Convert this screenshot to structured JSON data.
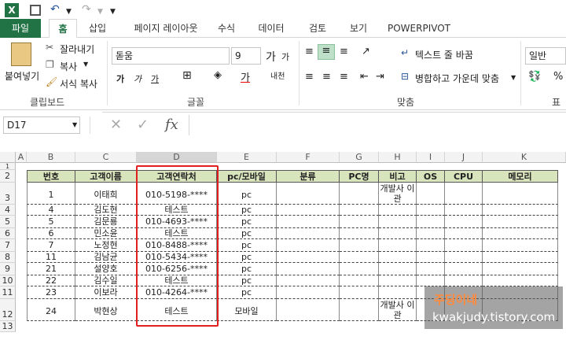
{
  "qat": {
    "excel_icon": "X",
    "save_icon": "save",
    "undo_icon": "↶",
    "redo_icon": "↷"
  },
  "tabs": [
    {
      "label": "파일"
    },
    {
      "label": "홈"
    },
    {
      "label": "삽입"
    },
    {
      "label": "페이지 레이아웃"
    },
    {
      "label": "수식"
    },
    {
      "label": "데이터"
    },
    {
      "label": "검토"
    },
    {
      "label": "보기"
    },
    {
      "label": "POWERPIVOT"
    }
  ],
  "ribbon": {
    "paste": "붙여넣기",
    "cut": "잘라내기",
    "copy": "복사",
    "format_painter": "서식 복사",
    "clipboard": "클립보드",
    "font_name": "돋움",
    "font_size": "9",
    "font_group": "글꼴",
    "grow": "가",
    "shrink": "가",
    "bold": "가",
    "italic": "가",
    "underline": "가",
    "font_color": "가",
    "phonetic": "내천",
    "wrap_text": "텍스트 줄 바꿈",
    "merge_center": "병합하고 가운데 맞춤",
    "align_group": "맞춤",
    "number_format": "일반",
    "number_group": "표시"
  },
  "formula": {
    "namebox": "D17",
    "fx": "fx",
    "cancel": "✕",
    "enter": "✓"
  },
  "columns": [
    "A",
    "B",
    "C",
    "D",
    "E",
    "F",
    "G",
    "H",
    "I",
    "J",
    "K"
  ],
  "header_row": [
    "번호",
    "고객이름",
    "고객연락처",
    "pc/모바일",
    "분류",
    "PC명",
    "비고",
    "OS",
    "CPU",
    "메모리"
  ],
  "rows": [
    {
      "rownum": "3",
      "no": "1",
      "name": "이태희",
      "phone": "010-5198-****",
      "type": "pc",
      "note": "개발사 이관"
    },
    {
      "rownum": "4",
      "no": "4",
      "name": "김도현",
      "phone": "테스트",
      "type": "pc",
      "note": ""
    },
    {
      "rownum": "5",
      "no": "5",
      "name": "김문룡",
      "phone": "010-4693-****",
      "type": "pc",
      "note": ""
    },
    {
      "rownum": "6",
      "no": "6",
      "name": "민소윤",
      "phone": "테스트",
      "type": "pc",
      "note": ""
    },
    {
      "rownum": "7",
      "no": "7",
      "name": "노정현",
      "phone": "010-8488-****",
      "type": "pc",
      "note": ""
    },
    {
      "rownum": "8",
      "no": "11",
      "name": "김남균",
      "phone": "010-5434-****",
      "type": "pc",
      "note": ""
    },
    {
      "rownum": "9",
      "no": "21",
      "name": "설양호",
      "phone": "010-6256-****",
      "type": "pc",
      "note": ""
    },
    {
      "rownum": "10",
      "no": "22",
      "name": "김수일",
      "phone": "테스트",
      "type": "pc",
      "note": ""
    },
    {
      "rownum": "11",
      "no": "23",
      "name": "이보라",
      "phone": "010-4264-****",
      "type": "pc",
      "note": ""
    },
    {
      "rownum": "12",
      "no": "24",
      "name": "박현상",
      "phone": "테스트",
      "type": "모바일",
      "note": "개발사 이관"
    }
  ],
  "rownums_top": [
    "1",
    "2"
  ],
  "rownum_last": "13",
  "watermark": {
    "line1": "주딩이네",
    "line2": "kwakjudy.tistory.com"
  },
  "colors": {
    "accent": "#217346",
    "header_fill": "#d8e4bc",
    "highlight": "#e02020"
  }
}
